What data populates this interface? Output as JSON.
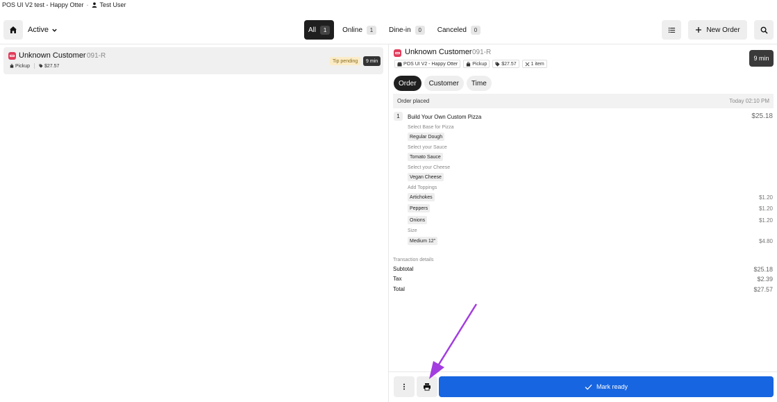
{
  "topbar": {
    "store": "POS UI V2 test - Happy Otter",
    "separator": "·",
    "user": "Test User"
  },
  "header": {
    "status_filter": "Active",
    "tabs": [
      {
        "label": "All",
        "count": "1",
        "active": true
      },
      {
        "label": "Online",
        "count": "1"
      },
      {
        "label": "Dine-in",
        "count": "0"
      },
      {
        "label": "Canceled",
        "count": "0"
      }
    ],
    "new_order_label": "New Order"
  },
  "order_list": [
    {
      "customer": "Unknown Customer",
      "order_id": "091-R",
      "mode": "Pickup",
      "amount": "$27.57",
      "tip_status": "Tip pending",
      "elapsed": "9 min"
    }
  ],
  "detail": {
    "customer": "Unknown Customer",
    "order_id": "091-R",
    "store": "POS UI V2 - Happy Otter",
    "mode": "Pickup",
    "amount": "$27.57",
    "items_count": "1 item",
    "elapsed": "9 min",
    "tabs": [
      "Order",
      "Customer",
      "Time"
    ],
    "placed_label": "Order placed",
    "placed_time": "Today 02:10 PM",
    "item": {
      "qty": "1",
      "name": "Build Your Own Custom Pizza",
      "price": "$25.18",
      "modifier_groups": [
        {
          "label": "Select Base for Pizza",
          "options": [
            {
              "name": "Regular Dough",
              "price": ""
            }
          ]
        },
        {
          "label": "Select your Sauce",
          "options": [
            {
              "name": "Tomato Sauce",
              "price": ""
            }
          ]
        },
        {
          "label": "Select your Cheese",
          "options": [
            {
              "name": "Vegan Cheese",
              "price": ""
            }
          ]
        },
        {
          "label": "Add Toppings",
          "options": [
            {
              "name": "Artichokes",
              "price": "$1.20"
            },
            {
              "name": "Peppers",
              "price": "$1.20"
            },
            {
              "name": "Onions",
              "price": "$1.20"
            }
          ]
        },
        {
          "label": "Size",
          "options": [
            {
              "name": "Medium 12\"",
              "price": "$4.80"
            }
          ]
        }
      ]
    },
    "transaction": {
      "label": "Transaction details",
      "subtotal_label": "Subtotal",
      "subtotal": "$25.18",
      "tax_label": "Tax",
      "tax": "$2.39",
      "total_label": "Total",
      "total": "$27.57"
    },
    "mark_ready_label": "Mark ready"
  },
  "colors": {
    "accent": "#1765e0",
    "online_badge": "#e13c5b",
    "annotation": "#a23de0"
  }
}
